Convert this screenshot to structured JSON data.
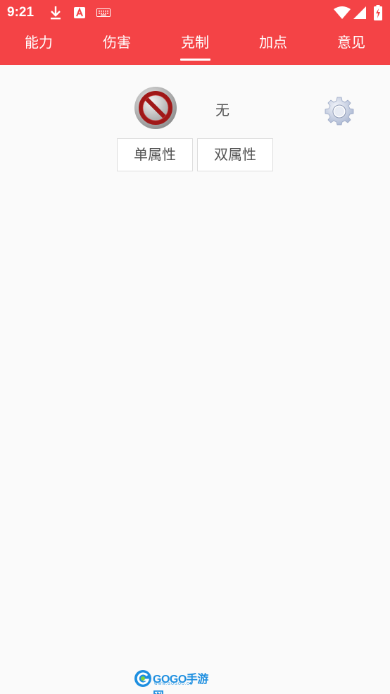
{
  "status_bar": {
    "time": "9:21",
    "icons": [
      "download-icon",
      "text-a-icon",
      "keyboard-icon",
      "wifi-icon",
      "signal-icon",
      "battery-charging-icon"
    ]
  },
  "tabs": [
    {
      "label": "能力",
      "active": false
    },
    {
      "label": "伤害",
      "active": false
    },
    {
      "label": "克制",
      "active": true
    },
    {
      "label": "加点",
      "active": false
    },
    {
      "label": "意见",
      "active": false
    }
  ],
  "selection": {
    "type_label": "无",
    "icon": "no-entry-icon"
  },
  "buttons": {
    "single": "单属性",
    "dual": "双属性"
  },
  "footer": {
    "logo_text": "GOGO手游网",
    "logo_sub": "WWW.GOGOO.CN"
  },
  "colors": {
    "accent": "#f44346",
    "background": "#fafafa",
    "logo": "#1e8fe0"
  }
}
